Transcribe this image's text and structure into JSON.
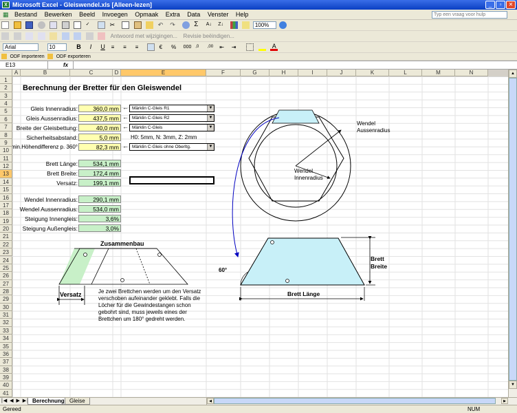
{
  "window": {
    "title": "Microsoft Excel - Gleiswendel.xls  [Alleen-lezen]",
    "logo": "X"
  },
  "menu": [
    "Bestand",
    "Bewerken",
    "Beeld",
    "Invoegen",
    "Opmaak",
    "Extra",
    "Data",
    "Venster",
    "Help"
  ],
  "help_placeholder": "Typ een vraag voor hulp",
  "toolbar": {
    "zoom": "100%",
    "reply_label": "Antwoord met wijzigingen...",
    "end_review_label": "Revisie beëindigen...",
    "font": "Arial",
    "font_size": "10",
    "odf_import": "ODF importeren",
    "odf_export": "ODF exporteren"
  },
  "formula": {
    "cell_ref": "E13",
    "fx": "fx",
    "value": ""
  },
  "columns": [
    "A",
    "B",
    "C",
    "D",
    "E",
    "F",
    "G",
    "H",
    "I",
    "J",
    "K",
    "L",
    "M",
    "N"
  ],
  "rows": [
    "1",
    "2",
    "3",
    "4",
    "5",
    "6",
    "7",
    "8",
    "9",
    "10",
    "11",
    "12",
    "13",
    "14",
    "15",
    "16",
    "17",
    "18",
    "19",
    "20",
    "21",
    "22",
    "23",
    "24",
    "25",
    "26",
    "27",
    "28",
    "29",
    "30",
    "31",
    "32",
    "33",
    "34",
    "35",
    "36",
    "37",
    "38",
    "39",
    "40",
    "41"
  ],
  "sheet": {
    "title": "Berechnung der Bretter für den Gleiswendel",
    "inputs": [
      {
        "label": "Gleis Innenradius:",
        "value": "360,0 mm",
        "arrow": "←",
        "select": "Märklin C-Gleis R1"
      },
      {
        "label": "Gleis Aussenradius:",
        "value": "437,5 mm",
        "arrow": "←",
        "select": "Märklin C-Gleis R2"
      },
      {
        "label": "Breite der Gleisbettung:",
        "value": "40,0 mm",
        "arrow": "←",
        "select": "Märklin C-Gleis"
      },
      {
        "label": "Sicherheitsabstand:",
        "value": "5,0 mm",
        "arrow": "",
        "note": "H0: 5mm, N: 3mm, Z: 2mm"
      },
      {
        "label": "min.Höhendifferenz p. 360°",
        "value": "82,3 mm",
        "arrow": "←",
        "select": "Märklin C-Gleis ohne Oberltg."
      }
    ],
    "board": [
      {
        "label": "Brett Länge:",
        "value": "534,1 mm"
      },
      {
        "label": "Brett Breite:",
        "value": "172,4 mm"
      },
      {
        "label": "Versatz:",
        "value": "199,1 mm"
      }
    ],
    "results": [
      {
        "label": "Wendel Innenradius:",
        "value": "290,1 mm"
      },
      {
        "label": "Wendel Aussenradius:",
        "value": "534,0 mm"
      },
      {
        "label": "Steigung Innengleis:",
        "value": "3,6%"
      },
      {
        "label": "Steigung Außengleis:",
        "value": "3,0%"
      }
    ],
    "assembly_title": "Zusammenbau",
    "versatz_label": "Versatz",
    "note": "Je zwei Brettchen werden um den Versatz verschoben aufeinander geklebt. Falls die Löcher für die Gewindestangen schon gebohrt sind, muss jeweils eines der Brettchen um 180° gedreht werden.",
    "wendel_outer_label": "Wendel Aussenradius",
    "wendel_inner_label": "Wendel Innenradius",
    "angle_label": "60°",
    "brett_breite_label": "Brett Breite",
    "brett_laenge_label": "Brett Länge"
  },
  "tabs": [
    "Berechnung",
    "Gleise"
  ],
  "status": {
    "left": "Gereed",
    "right": "NUM"
  },
  "colors": {
    "input_cell": "#ffffb0",
    "result_cell": "#c8f0c8",
    "board_fill": "#c8f0f8",
    "assembly_green": "#c8f0c8",
    "selection": "#ffc86a"
  }
}
